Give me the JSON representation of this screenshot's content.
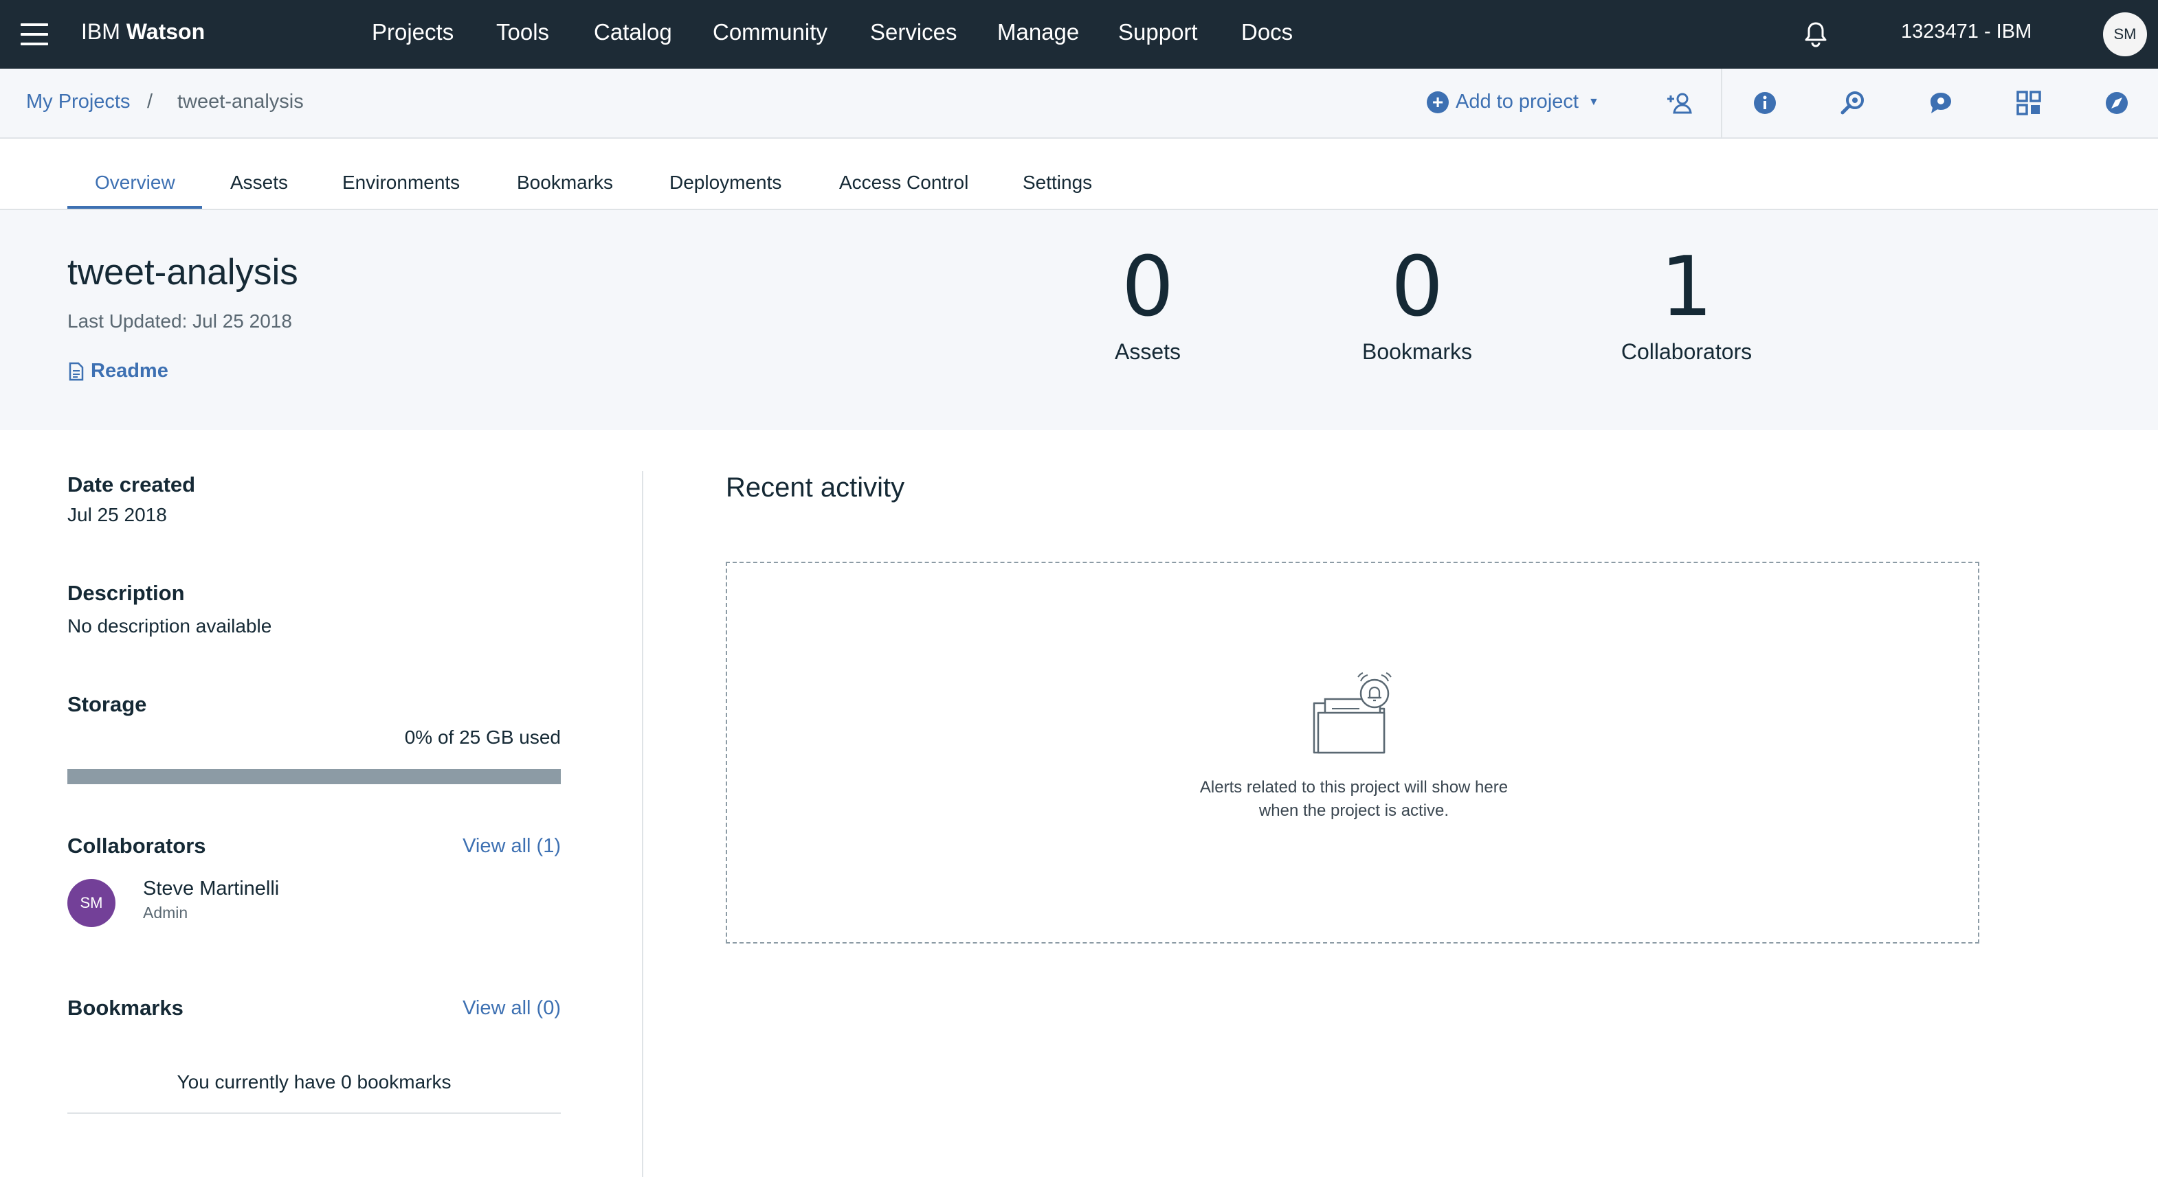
{
  "topnav": {
    "brand_prefix": "IBM",
    "brand_name": "Watson",
    "items": [
      "Projects",
      "Tools",
      "Catalog",
      "Community",
      "Services",
      "Manage",
      "Support",
      "Docs"
    ],
    "account": "1323471 - IBM",
    "avatar_initials": "SM",
    "background": "#1d2b36"
  },
  "breadcrumb": {
    "root": "My Projects",
    "separator": "/",
    "current": "tweet-analysis"
  },
  "toolbar": {
    "add_to_project": "Add to project",
    "icons": [
      "add-collaborator-icon",
      "info-icon",
      "search-assets-icon",
      "chat-icon",
      "apps-grid-icon",
      "compass-icon"
    ]
  },
  "tabs": [
    "Overview",
    "Assets",
    "Environments",
    "Bookmarks",
    "Deployments",
    "Access Control",
    "Settings"
  ],
  "active_tab": "Overview",
  "project": {
    "title": "tweet-analysis",
    "last_updated": "Last Updated: Jul 25 2018",
    "readme": "Readme"
  },
  "stats": [
    {
      "value": "0",
      "label": "Assets"
    },
    {
      "value": "0",
      "label": "Bookmarks"
    },
    {
      "value": "1",
      "label": "Collaborators"
    }
  ],
  "details": {
    "date_created_label": "Date created",
    "date_created": "Jul 25 2018",
    "description_label": "Description",
    "description": "No description available",
    "storage_label": "Storage",
    "storage_used": "0% of 25 GB used",
    "storage_fraction": 0.0,
    "collaborators_label": "Collaborators",
    "collaborators_viewall": "View all (1)",
    "collaborator": {
      "initials": "SM",
      "name": "Steve Martinelli",
      "role": "Admin"
    },
    "bookmarks_label": "Bookmarks",
    "bookmarks_viewall": "View all (0)",
    "bookmarks_empty": "You currently have 0 bookmarks"
  },
  "recent_activity": {
    "title": "Recent activity",
    "empty_line1": "Alerts related to this project will show here",
    "empty_line2": "when the project is active."
  },
  "colors": {
    "accent": "#3d70b2",
    "avatar_purple": "#734098",
    "storage_bar": "#8c9ba5"
  }
}
